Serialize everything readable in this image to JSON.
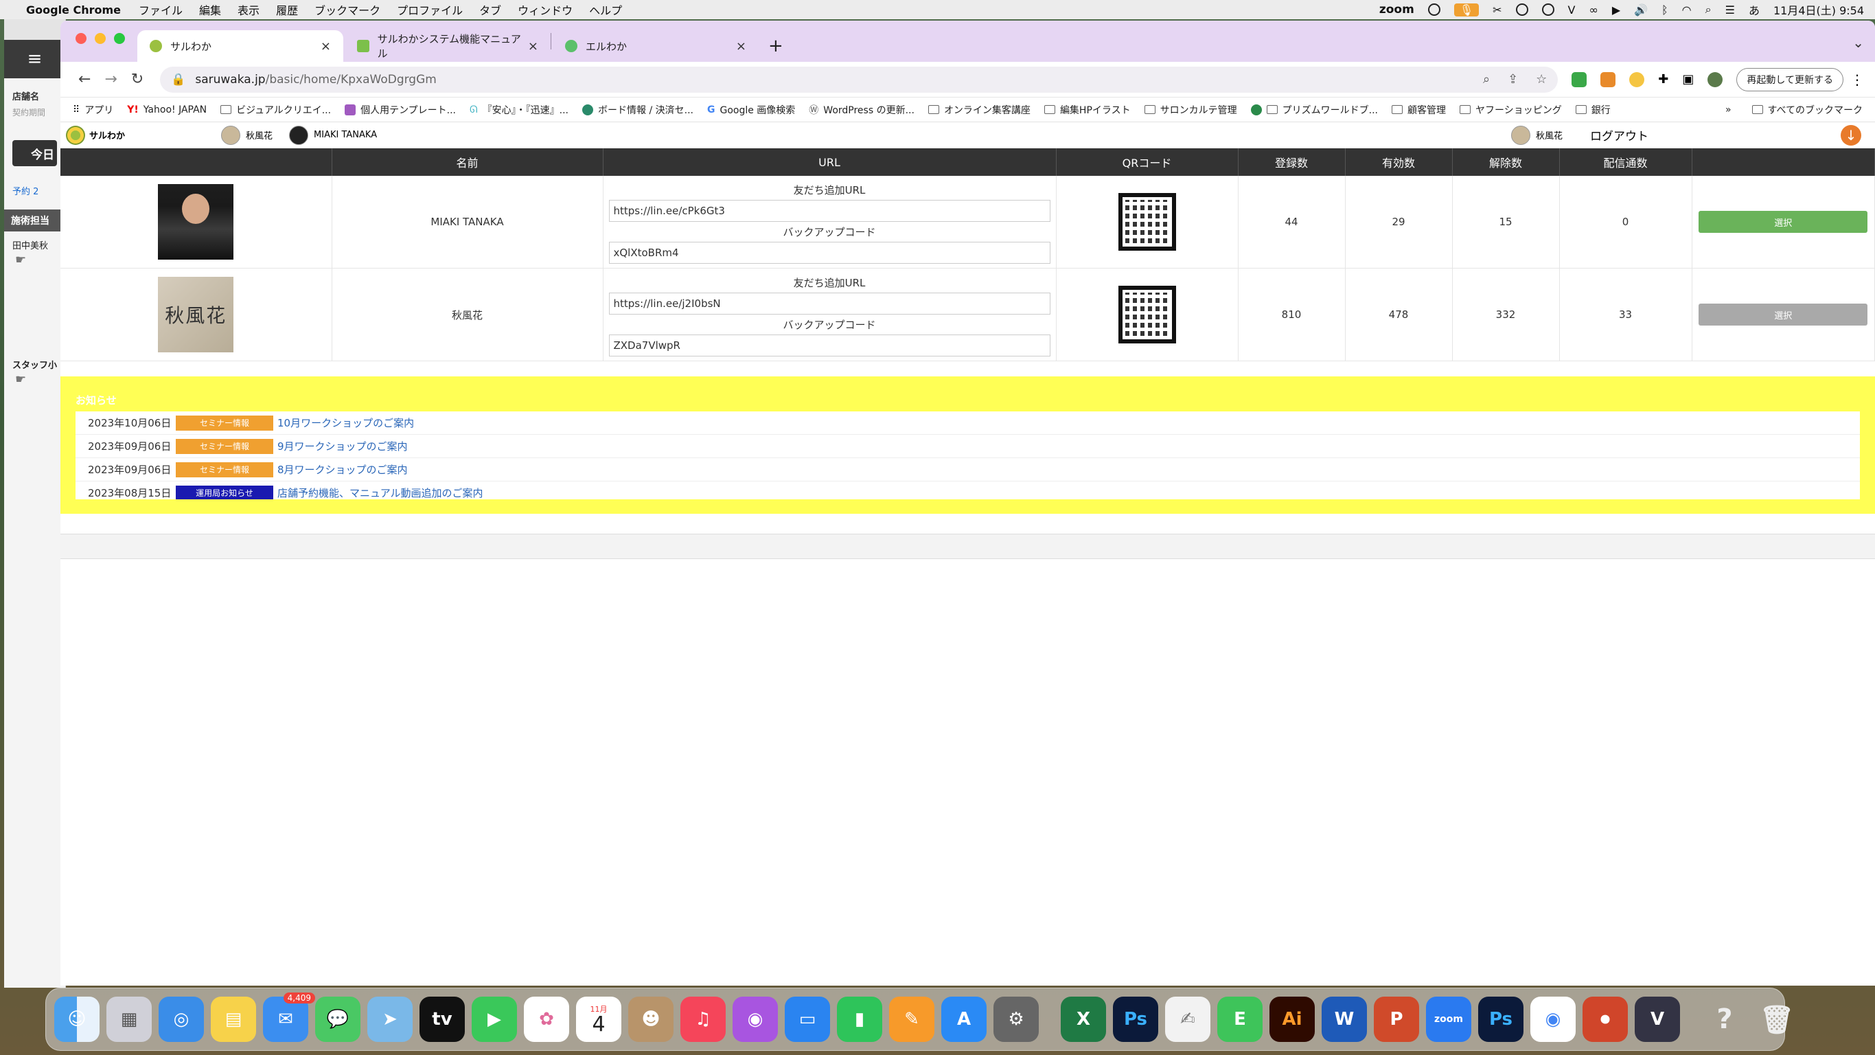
{
  "menubar": {
    "app_name": "Google Chrome",
    "menus": [
      "ファイル",
      "編集",
      "表示",
      "履歴",
      "ブックマーク",
      "プロファイル",
      "タブ",
      "ウィンドウ",
      "ヘルプ"
    ],
    "zoom_label": "zoom",
    "ime": "あ",
    "datetime": "11月4日(土) 9:54"
  },
  "bg_app": {
    "menu_icon": "≡",
    "label_store": "店舗名",
    "label_contract": "契約期間",
    "today_button": "今日",
    "reservation": "予約 2",
    "section_staff": "施術担当",
    "staff_name": "田中美秋",
    "section_staff2": "スタッフ小"
  },
  "tabs": [
    {
      "title": "サルわか",
      "active": true,
      "color": "#9bc040"
    },
    {
      "title": "サルわかシステム機能マニュアル",
      "active": false,
      "color": "#7cc04a"
    },
    {
      "title": "エルわか",
      "active": false,
      "color": "#5bc06a"
    }
  ],
  "address": {
    "url_host": "saruwaka.jp",
    "url_path": "/basic/home/KpxaWoDgrgGm",
    "relaunch_label": "再起動して更新する"
  },
  "bookmarks": [
    {
      "label": "アプリ",
      "icon": "apps-grid-icon"
    },
    {
      "label": "Yahoo! JAPAN",
      "icon": "yahoo-icon"
    },
    {
      "label": "ビジュアルクリエイ...",
      "icon": "folder-icon"
    },
    {
      "label": "個人用テンプレート...",
      "icon": "template-icon"
    },
    {
      "label": "『安心』・『迅速』...",
      "icon": "site-icon"
    },
    {
      "label": "ボード情報 / 決済セ...",
      "icon": "globe-icon"
    },
    {
      "label": "Google 画像検索",
      "icon": "google-icon"
    },
    {
      "label": "WordPress の更新...",
      "icon": "wordpress-icon"
    },
    {
      "label": "オンライン集客講座",
      "icon": "folder-icon"
    },
    {
      "label": "編集HPイラスト",
      "icon": "folder-icon"
    },
    {
      "label": "サロンカルテ管理",
      "icon": "folder-icon"
    },
    {
      "label": "プリズムワールドブ...",
      "icon": "folder-icon"
    },
    {
      "label": "顧客管理",
      "icon": "folder-icon"
    },
    {
      "label": "ヤフーショッピング",
      "icon": "folder-icon"
    },
    {
      "label": "銀行",
      "icon": "folder-icon"
    }
  ],
  "bookmarks_more": "»",
  "bookmarks_all": "すべてのブックマーク",
  "site": {
    "logo_text": "サルわか",
    "accounts": [
      "秋風花",
      "MIAKI TANAKA"
    ],
    "current_account": "秋風花",
    "logout": "ログアウト"
  },
  "table": {
    "headers": [
      "",
      "名前",
      "URL",
      "QRコード",
      "登録数",
      "有効数",
      "解除数",
      "配信通数",
      ""
    ],
    "friend_url_label": "友だち追加URL",
    "backup_code_label": "バックアップコード",
    "rows": [
      {
        "name": "MIAKI TANAKA",
        "url": "https://lin.ee/cPk6Gt3",
        "backup": "xQlXtoBRm4",
        "registered": "44",
        "active": "29",
        "cancelled": "15",
        "deliveries": "0",
        "button": "選択",
        "button_state": "selected"
      },
      {
        "name": "秋風花",
        "url": "https://lin.ee/j2I0bsN",
        "backup": "ZXDa7VlwpR",
        "registered": "810",
        "active": "478",
        "cancelled": "332",
        "deliveries": "33",
        "button": "選択",
        "button_state": "unselected"
      }
    ]
  },
  "news": {
    "title": "お知らせ",
    "items": [
      {
        "date": "2023年10月06日",
        "category": "セミナー情報",
        "category_color": "#f0a030",
        "text": "10月ワークショップのご案内"
      },
      {
        "date": "2023年09月06日",
        "category": "セミナー情報",
        "category_color": "#f0a030",
        "text": "9月ワークショップのご案内"
      },
      {
        "date": "2023年09月06日",
        "category": "セミナー情報",
        "category_color": "#f0a030",
        "text": "8月ワークショップのご案内"
      },
      {
        "date": "2023年08月15日",
        "category": "運用局お知らせ",
        "category_color": "#1a1ab0",
        "text": "店舗予約機能、マニュアル動画追加のご案内"
      }
    ]
  },
  "dock": {
    "mail_badge": "4,409",
    "calendar_month": "11月",
    "calendar_day": "4",
    "apps": [
      "finder",
      "launchpad",
      "safari",
      "notes",
      "mail",
      "messages",
      "maps",
      "apple-tv",
      "facetime",
      "photos",
      "calendar",
      "contacts",
      "music",
      "podcasts",
      "keynote",
      "numbers",
      "pages",
      "app-store",
      "system-settings",
      "excel",
      "photoshop",
      "textedit",
      "evernote",
      "illustrator",
      "word",
      "powerpoint",
      "zoom",
      "photoshop-2",
      "chrome",
      "screen-recorder",
      "vectorworks",
      "help",
      "trash"
    ]
  }
}
